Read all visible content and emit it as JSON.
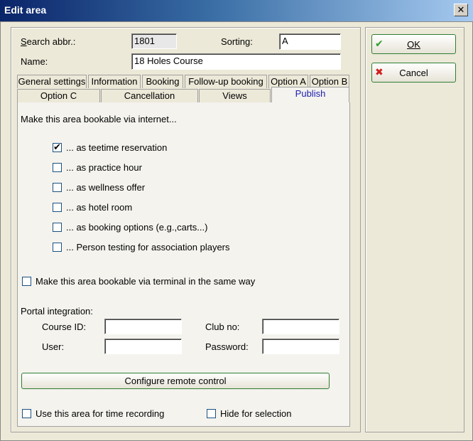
{
  "window": {
    "title": "Edit area",
    "close_glyph": "✕"
  },
  "fields": {
    "search_abbr": {
      "label": "Search abbr.:",
      "value": "1801"
    },
    "sorting": {
      "label": "Sorting:",
      "value": "A"
    },
    "name": {
      "label": "Name:",
      "value": "18 Holes Course"
    }
  },
  "tabs_row1": [
    "General settings",
    "Information",
    "Booking",
    "Follow-up booking",
    "Option A",
    "Option B"
  ],
  "tabs_row2": [
    "Option C",
    "Cancellation",
    "Views",
    "Publish"
  ],
  "active_tab": "Publish",
  "publish": {
    "intro": "Make this area bookable via internet...",
    "options": [
      {
        "label": "... as teetime reservation",
        "checked": true
      },
      {
        "label": "... as practice hour",
        "checked": false
      },
      {
        "label": "... as wellness offer",
        "checked": false
      },
      {
        "label": "... as hotel room",
        "checked": false
      },
      {
        "label": "... as booking options (e.g.,carts...)",
        "checked": false
      },
      {
        "label": "... Person testing for association players",
        "checked": false
      }
    ],
    "terminal": {
      "label": "Make this area bookable via terminal in the same way",
      "checked": false
    },
    "portal": {
      "heading": "Portal integration:",
      "course_id": {
        "label": "Course ID:",
        "value": ""
      },
      "club_no": {
        "label": "Club no:",
        "value": ""
      },
      "user": {
        "label": "User:",
        "value": ""
      },
      "password": {
        "label": "Password:",
        "value": ""
      }
    },
    "configure_button": "Configure remote control",
    "time_recording": {
      "label": "Use this area for time recording",
      "checked": false
    },
    "hide_selection": {
      "label": "Hide for selection",
      "checked": false
    }
  },
  "buttons": {
    "ok": {
      "label": "OK",
      "icon": "check-icon",
      "color": "#2e9d2e"
    },
    "cancel": {
      "label": "Cancel",
      "icon": "x-icon",
      "color": "#d02020"
    }
  }
}
